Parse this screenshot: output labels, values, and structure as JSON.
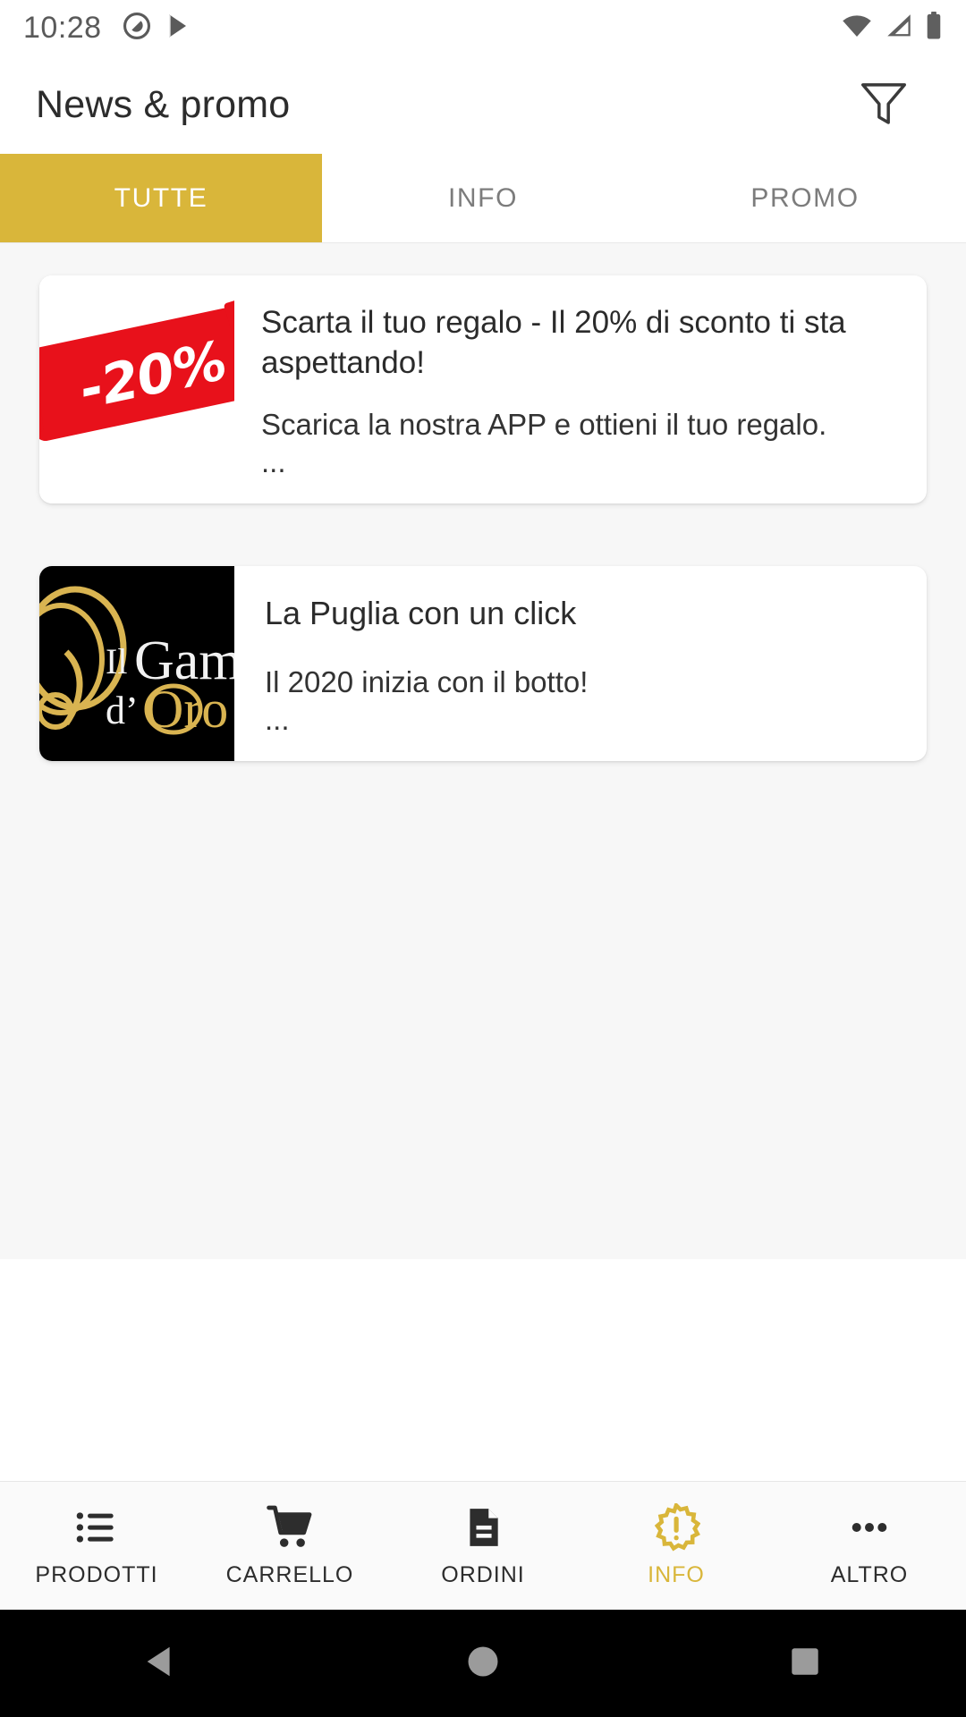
{
  "statusbar": {
    "time": "10:28",
    "left_icons": [
      "dnd-circle-icon",
      "play-store-icon"
    ],
    "right_icons": [
      "wifi-icon",
      "cellular-signal-icon",
      "battery-icon"
    ]
  },
  "appbar": {
    "title": "News & promo",
    "filter_icon": "filter-icon"
  },
  "tabs": [
    {
      "label": "TUTTE",
      "active": true
    },
    {
      "label": "INFO",
      "active": false
    },
    {
      "label": "PROMO",
      "active": false
    }
  ],
  "cards": [
    {
      "thumb": "promo-20-percent-image",
      "thumb_text": "-20%",
      "title": "Scarta il tuo regalo - Il 20% di sconto ti sta aspettando!",
      "desc": "Scarica la nostra APP e ottieni il tuo regalo.",
      "ellipsis": "..."
    },
    {
      "thumb": "il-gambero-doro-logo-image",
      "logo_line1": "Il Gam",
      "logo_line2": "d'Oro",
      "title": "La Puglia con un click",
      "desc": "Il 2020 inizia con il botto!",
      "ellipsis": "..."
    }
  ],
  "bottomnav": [
    {
      "label": "PRODOTTI",
      "icon": "list-icon",
      "active": false
    },
    {
      "label": "CARRELLO",
      "icon": "shopping-cart-icon",
      "active": false
    },
    {
      "label": "ORDINI",
      "icon": "document-icon",
      "active": false
    },
    {
      "label": "INFO",
      "icon": "info-burst-icon",
      "active": true
    },
    {
      "label": "ALTRO",
      "icon": "more-dots-icon",
      "active": false
    }
  ],
  "sysnav": [
    {
      "name": "back-button",
      "icon": "triangle-back-icon"
    },
    {
      "name": "home-button",
      "icon": "circle-home-icon"
    },
    {
      "name": "recents-button",
      "icon": "square-recents-icon"
    }
  ],
  "colors": {
    "accent_gold": "#d9b63a",
    "promo_red": "#e8111b",
    "logo_gold": "#d9b451",
    "content_bg": "#f7f7f7"
  }
}
